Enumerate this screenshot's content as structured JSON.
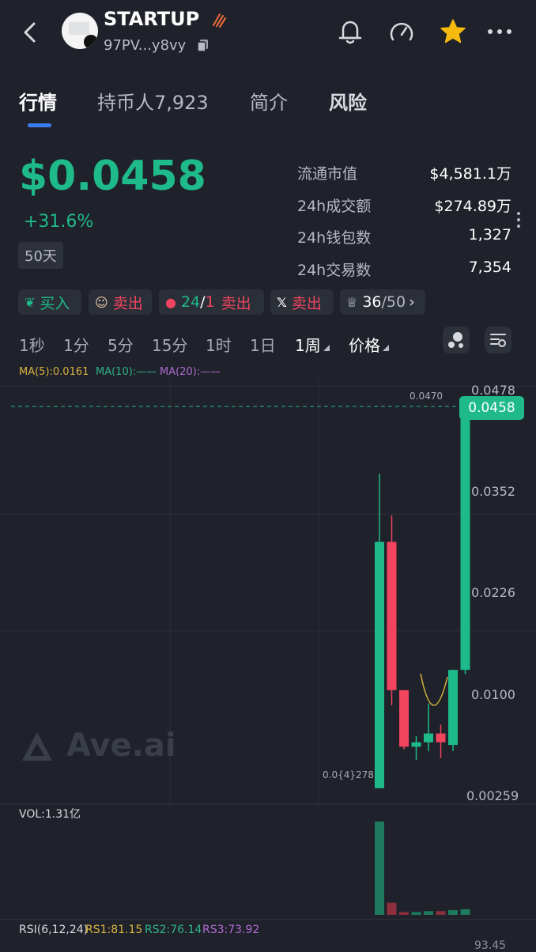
{
  "header": {
    "token_name": "STARTUP",
    "address": "97PV...y8vy",
    "icons": [
      "back-icon",
      "bell-icon",
      "gauge-icon",
      "star-icon",
      "more-icon",
      "flame-icon",
      "copy-icon"
    ]
  },
  "tabs": [
    {
      "label": "行情"
    },
    {
      "label": "持币人7,923"
    },
    {
      "label": "简介"
    },
    {
      "label": "风险"
    }
  ],
  "price": {
    "value": "$0.0458",
    "change": "+31.6%",
    "age": "50天"
  },
  "stats": [
    {
      "label": "流通市值",
      "value": "$4,581.1万"
    },
    {
      "label": "24h成交额",
      "value": "$274.89万"
    },
    {
      "label": "24h钱包数",
      "value": "1,327"
    },
    {
      "label": "24h交易数",
      "value": "7,354"
    }
  ],
  "actions": {
    "buy": "买入",
    "sell1": "卖出",
    "ratio_a": "24",
    "ratio_sep": "/",
    "ratio_b": "1",
    "sell2": "卖出",
    "x_sell": "卖出",
    "score_a": "36",
    "score_sep": "/50"
  },
  "timeframes": [
    "1秒",
    "1分",
    "5分",
    "15分",
    "1时",
    "1日",
    "1周",
    "价格"
  ],
  "indicators": {
    "ma5": "MA(5):0.0161",
    "ma10": "MA(10):——",
    "ma20": "MA(20):——",
    "vol": "VOL:1.31亿",
    "rsi": "RSI(6,12,24)",
    "rs1": "RS1:81.15",
    "rs2": "RS2:76.14",
    "rs3": "RS3:73.92"
  },
  "colors": {
    "up": "#1fba8a",
    "down": "#f0445f",
    "accent": "#3a7bf0",
    "star": "#f5b90f"
  },
  "chart_data": {
    "type": "candlestick",
    "y_axis_labels": [
      "0.0478",
      "0.0352",
      "0.0226",
      "0.0100",
      "0.00259"
    ],
    "current_price_tag": "0.0458",
    "high_label": "0.0470",
    "low_label": "0.0{4}278",
    "rsi_top_label": "93.45",
    "watermark": "Ave.ai",
    "candles": [
      {
        "o": 0.0026,
        "h": 0.0382,
        "l": 0.0026,
        "c": 0.0305,
        "dir": "up"
      },
      {
        "o": 0.0305,
        "h": 0.0335,
        "l": 0.012,
        "c": 0.0137,
        "dir": "down"
      },
      {
        "o": 0.0137,
        "h": 0.0137,
        "l": 0.007,
        "c": 0.0073,
        "dir": "down"
      },
      {
        "o": 0.0073,
        "h": 0.0085,
        "l": 0.0058,
        "c": 0.0078,
        "dir": "up"
      },
      {
        "o": 0.0078,
        "h": 0.0122,
        "l": 0.0068,
        "c": 0.0088,
        "dir": "up"
      },
      {
        "o": 0.0088,
        "h": 0.0098,
        "l": 0.006,
        "c": 0.0078,
        "dir": "down"
      },
      {
        "o": 0.0075,
        "h": 0.0135,
        "l": 0.0068,
        "c": 0.016,
        "dir": "up"
      },
      {
        "o": 0.016,
        "h": 0.047,
        "l": 0.0155,
        "c": 0.0458,
        "dir": "up"
      }
    ],
    "volume": [
      1.0,
      0.13,
      0.03,
      0.03,
      0.04,
      0.04,
      0.05,
      0.06
    ]
  }
}
